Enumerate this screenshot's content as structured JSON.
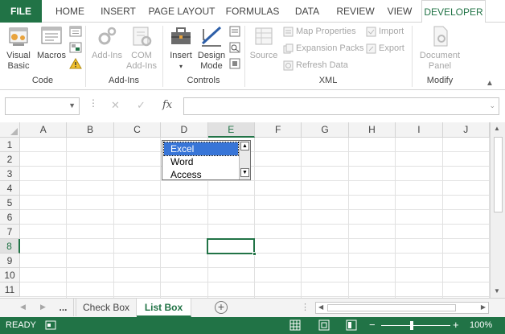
{
  "ribbon_tabs": {
    "file": "FILE",
    "home": "HOME",
    "insert": "INSERT",
    "page_layout": "PAGE LAYOUT",
    "formulas": "FORMULAS",
    "data": "DATA",
    "review": "REVIEW",
    "view": "VIEW",
    "developer": "DEVELOPER"
  },
  "ribbon": {
    "code": {
      "label": "Code",
      "visual_basic_line1": "Visual",
      "visual_basic_line2": "Basic",
      "macros": "Macros"
    },
    "addins": {
      "label": "Add-Ins",
      "addins_btn": "Add-Ins",
      "com_line1": "COM",
      "com_line2": "Add-Ins"
    },
    "controls": {
      "label": "Controls",
      "insert": "Insert",
      "design_line1": "Design",
      "design_line2": "Mode"
    },
    "xml": {
      "label": "XML",
      "source": "Source",
      "map_properties": "Map Properties",
      "expansion_packs": "Expansion Packs",
      "refresh_data": "Refresh Data",
      "import": "Import",
      "export": "Export"
    },
    "modify": {
      "label": "Modify",
      "doc_line1": "Document",
      "doc_line2": "Panel"
    }
  },
  "formula_bar": {
    "name_box": "",
    "cancel_symbol": "✕",
    "enter_symbol": "✓",
    "fx_symbol": "fx",
    "formula": ""
  },
  "grid": {
    "columns": [
      "A",
      "B",
      "C",
      "D",
      "E",
      "F",
      "G",
      "H",
      "I",
      "J"
    ],
    "rows": [
      "1",
      "2",
      "3",
      "4",
      "5",
      "6",
      "7",
      "8",
      "9",
      "10",
      "11"
    ],
    "selected_column": "E",
    "selected_row": "8"
  },
  "list_box": {
    "items": [
      "Excel",
      "Word",
      "Access"
    ],
    "selected": "Excel"
  },
  "sheets": {
    "more": "...",
    "tabs": [
      "Check Box",
      "List Box"
    ],
    "active": "List Box"
  },
  "status_bar": {
    "mode": "READY",
    "zoom": "100%",
    "zoom_minus": "−",
    "zoom_plus": "+"
  },
  "colors": {
    "accent": "#217346",
    "listbox_selection": "#3875d7"
  }
}
